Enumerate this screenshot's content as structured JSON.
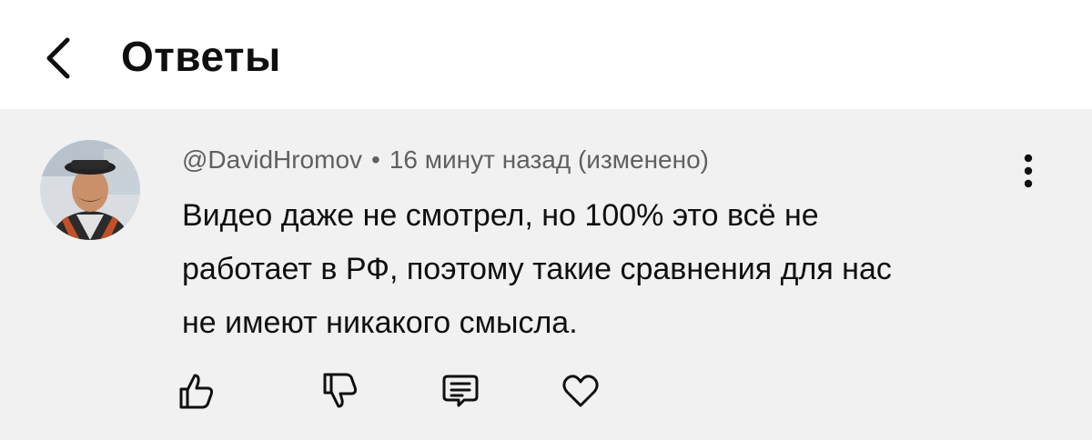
{
  "header": {
    "title": "Ответы",
    "back_icon": "chevron-left-icon"
  },
  "comment": {
    "author": "@DavidHromov",
    "separator": "•",
    "time": "16 минут назад (изменено)",
    "text_lines": [
      "Видео даже не смотрел, но 100% это всё не",
      "работает в РФ, поэтому такие сравнения для нас",
      "не имеют никакого смысла."
    ],
    "more_icon": "more-vertical-icon",
    "actions": {
      "like_icon": "thumbs-up-icon",
      "dislike_icon": "thumbs-down-icon",
      "reply_icon": "comment-icon",
      "heart_icon": "heart-icon"
    }
  },
  "colors": {
    "background": "#ffffff",
    "comment_background": "#f1f1f1",
    "text": "#0f0f0f",
    "secondary_text": "#606060"
  }
}
